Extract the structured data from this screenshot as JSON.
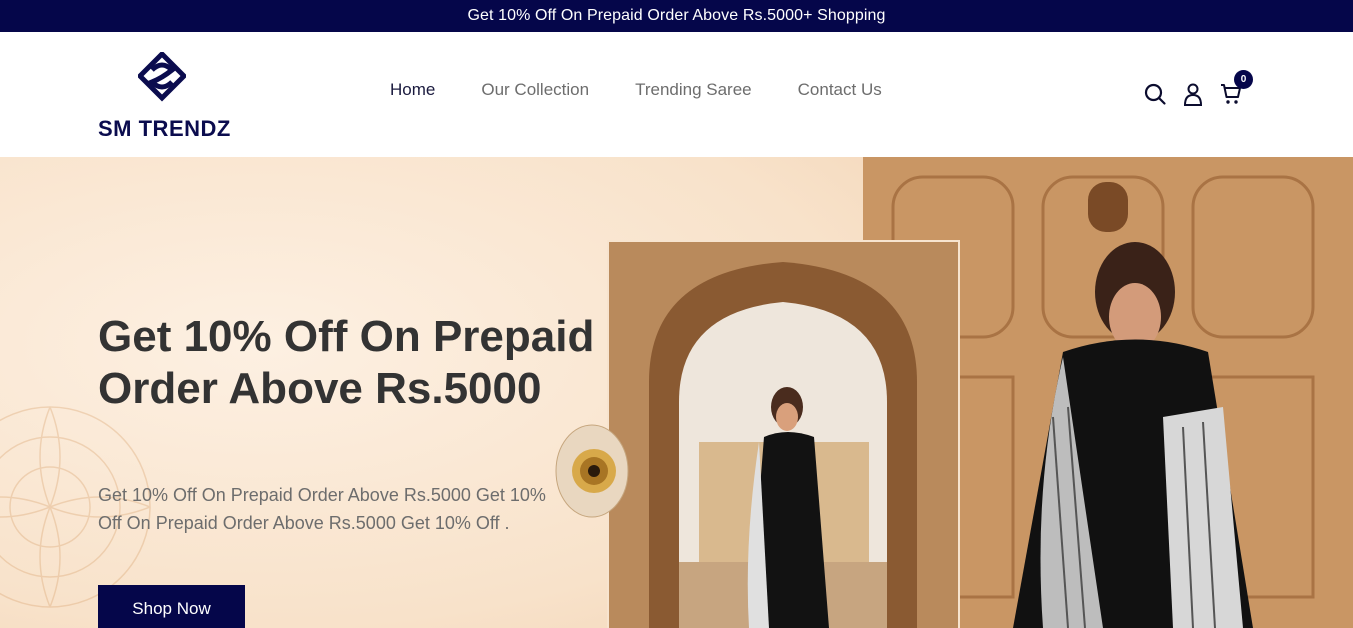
{
  "announcement": {
    "text": "Get 10% Off On Prepaid Order Above Rs.5000+ Shopping"
  },
  "brand": {
    "name": "SM TRENDZ"
  },
  "nav": {
    "items": [
      {
        "label": "Home",
        "active": true
      },
      {
        "label": "Our Collection",
        "active": false
      },
      {
        "label": "Trending Saree",
        "active": false
      },
      {
        "label": "Contact Us",
        "active": false
      }
    ]
  },
  "header_icons": {
    "search": "search-icon",
    "account": "user-icon",
    "cart": "cart-icon",
    "cart_count": "0"
  },
  "hero": {
    "title": "Get 10% Off On Prepaid Order Above Rs.5000",
    "description": "Get 10% Off On Prepaid Order Above Rs.5000 Get 10% Off On Prepaid Order Above Rs.5000 Get 10% Off .",
    "cta_label": "Shop Now"
  },
  "colors": {
    "brand_navy": "#05064a",
    "hero_bg": "#fae6d2",
    "heading": "#333333",
    "muted_text": "#6d6d6d"
  }
}
